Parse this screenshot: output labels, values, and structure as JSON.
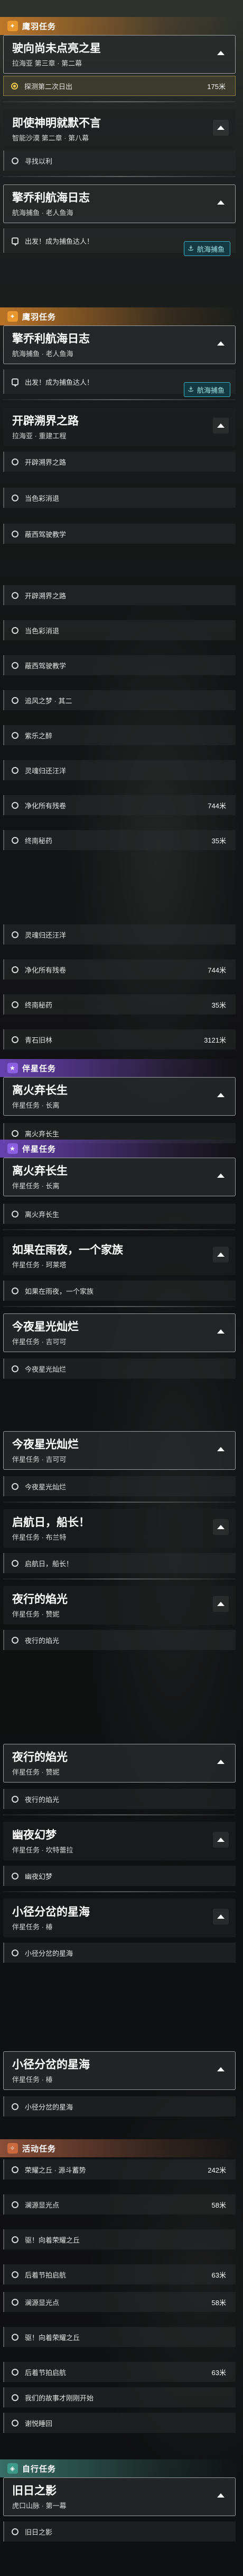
{
  "sections": {
    "main": "鹰羽任务",
    "daily": "鹰羽任务",
    "companion": "伴星任务",
    "event": "活动任务",
    "explore": "自行任务"
  },
  "q1": {
    "title": "驶向尚未点亮之星",
    "sub": "拉海亚 第三章 · 第二幕"
  },
  "q1_steps": [
    {
      "text": "探测第二次日出",
      "dist": "175米"
    }
  ],
  "q2": {
    "title": "即使神明就默不言",
    "sub": "智能沙漠 第二章 · 第八幕"
  },
  "q2_steps": [
    {
      "text": "寻找以利"
    }
  ],
  "q3": {
    "title": "擎乔利航海日志",
    "sub": "航海捕鱼 · 老人鱼海"
  },
  "q3_step": {
    "text": "出发！成为捕鱼达人！",
    "tag": "航海捕鱼"
  },
  "q4": {
    "title": "擎乔利航海日志",
    "sub": "航海捕鱼 · 老人鱼海"
  },
  "q4_step": {
    "text": "出发！成为捕鱼达人！",
    "tag": "航海捕鱼"
  },
  "q5": {
    "title": "开辟溯界之路",
    "sub": "拉海亚 · 重建工程"
  },
  "q5_steps": [
    {
      "text": "开辟溯界之路"
    },
    {
      "text": "当色彩消退"
    },
    {
      "text": "蔽西驾驶教学"
    }
  ],
  "q5_steps_b": [
    {
      "text": "开辟溯界之路"
    },
    {
      "text": "当色彩消退"
    },
    {
      "text": "蔽西驾驶教学"
    },
    {
      "text": "追风之梦 · 其二"
    },
    {
      "text": "紫乐之醉"
    },
    {
      "text": "灵魂归还汪洋"
    },
    {
      "text": "净化所有残卷",
      "dist": "744米"
    },
    {
      "text": "终南秘药",
      "dist": "35米"
    }
  ],
  "q5_steps_c": [
    {
      "text": "灵魂归还汪洋"
    },
    {
      "text": "净化所有残卷",
      "dist": "744米"
    },
    {
      "text": "终南秘药",
      "dist": "35米"
    },
    {
      "text": "青石旧林",
      "dist": "3121米"
    }
  ],
  "q6": {
    "title": "离火弃长生",
    "sub": "伴星任务 · 长离"
  },
  "q6_step": {
    "text": "离火弃长生"
  },
  "q7": {
    "title": "离火弃长生",
    "sub": "伴星任务 · 长离"
  },
  "q7_step": {
    "text": "离火弃长生"
  },
  "q8": {
    "title": "如果在雨夜，一个家族",
    "sub": "伴星任务 · 珂莱塔"
  },
  "q8_step": {
    "text": "如果在雨夜，一个家族"
  },
  "q9": {
    "title": "今夜星光灿烂",
    "sub": "伴星任务 · 吉可可"
  },
  "q9_step": {
    "text": "今夜星光灿烂"
  },
  "q10": {
    "title": "今夜星光灿烂",
    "sub": "伴星任务 · 吉可可"
  },
  "q10_step": {
    "text": "今夜星光灿烂"
  },
  "q11": {
    "title": "启航日，船长！",
    "sub": "伴星任务 · 布兰特"
  },
  "q11_step": {
    "text": "启航日，船长！"
  },
  "q12": {
    "title": "夜行的焰光",
    "sub": "伴星任务 · 赞妮"
  },
  "q12_step": {
    "text": "夜行的焰光"
  },
  "q13": {
    "title": "夜行的焰光",
    "sub": "伴星任务 · 赞妮"
  },
  "q13_step": {
    "text": "夜行的焰光"
  },
  "q14": {
    "title": "幽夜幻梦",
    "sub": "伴星任务 · 坎特蕾拉"
  },
  "q14_step": {
    "text": "幽夜幻梦"
  },
  "q15": {
    "title": "小径分岔的星海",
    "sub": "伴星任务 · 椿"
  },
  "q15_step": {
    "text": "小径分岔的星海"
  },
  "q16": {
    "title": "小径分岔的星海",
    "sub": "伴星任务 · 椿"
  },
  "q16_step": {
    "text": "小径分岔的星海"
  },
  "q17_steps": [
    {
      "text": "荣耀之丘 · 源斗蓄势",
      "dist": "242米"
    },
    {
      "text": "澜源显光点",
      "dist": "58米"
    },
    {
      "text": "驱！向着荣耀之丘"
    },
    {
      "text": "后着节拍启航",
      "dist": "63米"
    }
  ],
  "q18_steps": [
    {
      "text": "澜源显光点",
      "dist": "58米"
    },
    {
      "text": "驱！向着荣耀之丘"
    },
    {
      "text": "后着节拍启航",
      "dist": "63米"
    },
    {
      "text": "我们的故事才刚刚开始"
    },
    {
      "text": "谢悦睡回"
    }
  ],
  "q19": {
    "title": "旧日之影",
    "sub": "虎口山脉 · 第一幕"
  },
  "q19_step": {
    "text": "旧日之影"
  }
}
